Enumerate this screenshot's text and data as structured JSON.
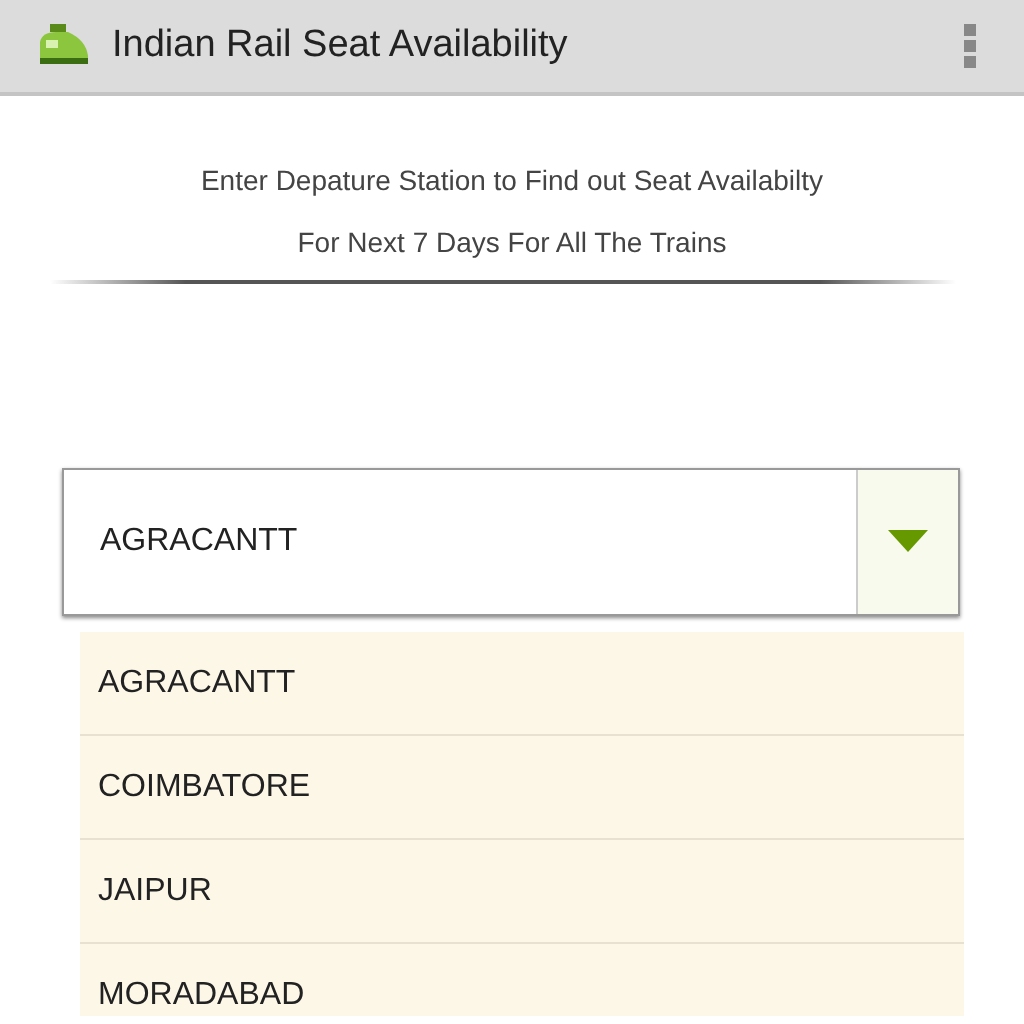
{
  "action_bar": {
    "title": "Indian Rail Seat Availability"
  },
  "intro": [
    "Enter Depature Station to Find out Seat Availabilty",
    "For Next 7 Days For All The Trains"
  ],
  "station_dropdown": {
    "value": "AGRACANTT",
    "expanded": true
  },
  "options": [
    {
      "label": "AGRACANTT"
    },
    {
      "label": "COIMBATORE"
    },
    {
      "label": "JAIPUR"
    },
    {
      "label": "MORADABAD"
    }
  ]
}
